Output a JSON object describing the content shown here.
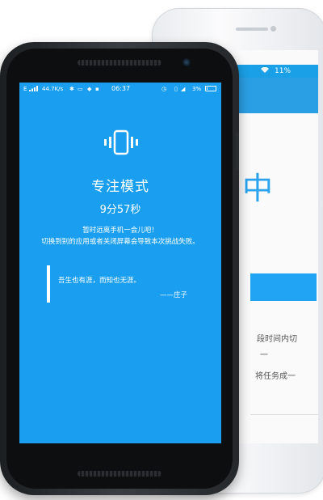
{
  "status_bar": {
    "carrier": "E",
    "network_speed": "44.7K/s",
    "time": "06:37",
    "battery": "3%"
  },
  "focus_mode": {
    "icon": "vibrate-phone-icon",
    "title": "专注模式",
    "countdown": "9分57秒",
    "tip_line1": "暂时远离手机一会儿吧！",
    "tip_line2": "切换到别的应用或者关闭屏幕会导致本次挑战失败。",
    "quote": "吾生也有涯，而知也无涯。",
    "quote_author": "——庄子"
  },
  "back_phone": {
    "battery": "11%",
    "headline_partial": "中",
    "text_line1": "段时间内切",
    "text_line2": "一",
    "text_line3": "将任务成一"
  },
  "colors": {
    "screen_blue": "#1a9ff0",
    "accent_blue": "#2ba3ee"
  }
}
